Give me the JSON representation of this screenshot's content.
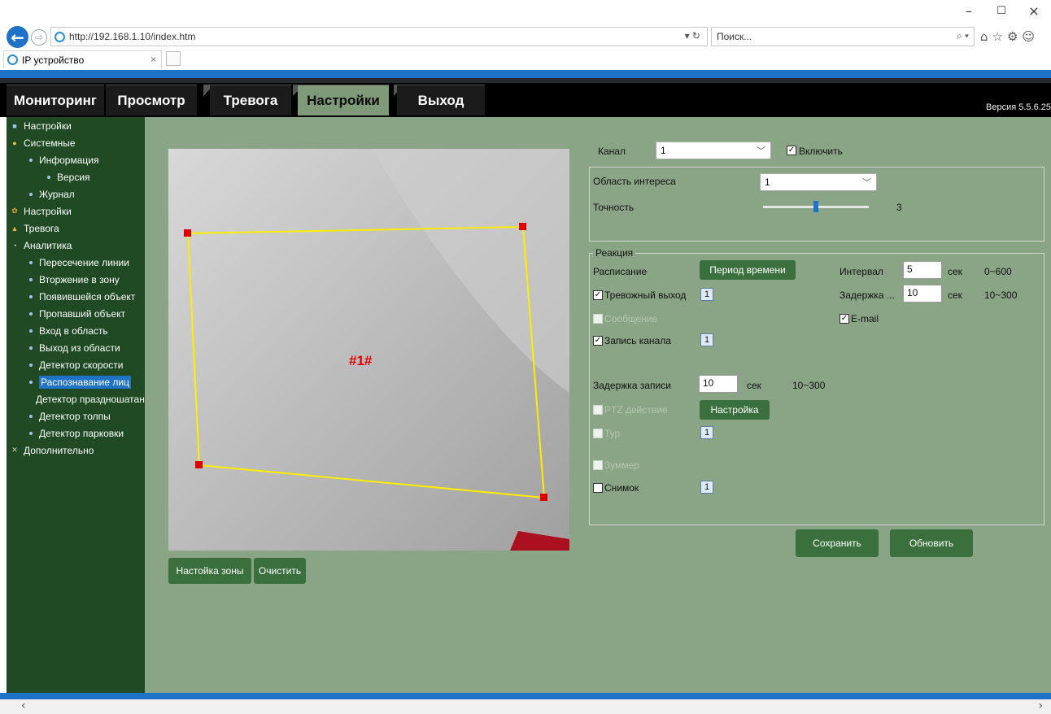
{
  "browser": {
    "url": "http://192.168.1.10/index.htm",
    "url_tools": "▾ ↻",
    "search_placeholder": "Поиск...",
    "search_tools": "⌕ ▾",
    "tab_title": "IP устройство",
    "tab_close": "×",
    "minimize": "–",
    "maximize": "☐",
    "close": "×",
    "back_glyph": "←",
    "forward_glyph": "⇨",
    "fav_icons": "⌂☆⚙☺",
    "scroll_left": "‹",
    "scroll_right": "›"
  },
  "header": {
    "tabs": [
      {
        "label": "Мониторинг"
      },
      {
        "label": "Просмотр"
      },
      {
        "label": "Тревога"
      },
      {
        "label": "Настройки",
        "active": true
      },
      {
        "label": "Выход"
      }
    ],
    "version": "Версия 5.5.6.25"
  },
  "sidebar": {
    "items": [
      {
        "label": "Настройки",
        "icon": "settings-icon",
        "glyph": "■",
        "color": "#9fc3ee"
      },
      {
        "label": "Системные",
        "icon": "system-icon",
        "glyph": "●",
        "color": "#e6c33a"
      },
      {
        "label": "Информация"
      },
      {
        "label": "Версия"
      },
      {
        "label": "Журнал"
      },
      {
        "label": "Настройки",
        "icon": "gear-icon",
        "glyph": "✿",
        "color": "#f0a030"
      },
      {
        "label": "Тревога",
        "icon": "alarm-icon",
        "glyph": "▲",
        "color": "#f0b040"
      },
      {
        "label": "Аналитика",
        "icon": "analytics-icon",
        "glyph": "◔",
        "color": "#dddddd"
      },
      {
        "label": "Пересечение линии"
      },
      {
        "label": "Вторжение в зону"
      },
      {
        "label": "Появившейся объект"
      },
      {
        "label": "Пропавший объект"
      },
      {
        "label": "Вход в область"
      },
      {
        "label": "Выход из области"
      },
      {
        "label": "Детектор скорости"
      },
      {
        "label": "Распознавание лиц",
        "selected": true
      },
      {
        "label": "Детектор праздношатания"
      },
      {
        "label": "Детектор толпы"
      },
      {
        "label": "Детектор парковки"
      },
      {
        "label": "Дополнительно",
        "icon": "tools-icon",
        "glyph": "✕",
        "color": "#cccccc"
      }
    ]
  },
  "video": {
    "zone_label": "#1#",
    "zone_color": "#ffee00",
    "handle_color": "#dd0000"
  },
  "zone_buttons": {
    "setup": "Настойка зоны",
    "clear": "Очистить"
  },
  "settings": {
    "channel_label": "Канал",
    "channel_value": "1",
    "enable_label": "Включить",
    "enable_checked": true,
    "roi_label": "Область интереса",
    "roi_value": "1",
    "accuracy_label": "Точность",
    "accuracy_value": "3",
    "accuracy_level": 0.5,
    "reaction_legend": "Реакция",
    "schedule_label": "Расписание",
    "schedule_button": "Период времени",
    "interval_label": "Интервал",
    "interval_value": "5",
    "interval_unit": "сек",
    "interval_range": "0~600",
    "alarm_out_label": "Тревожный выход",
    "alarm_out_num": "1",
    "delay_label": "Задержка ...",
    "delay_value": "10",
    "delay_unit": "сек",
    "delay_range": "10~300",
    "message_label": "Сообщение",
    "email_label": "E-mail",
    "record_label": "Запись канала",
    "record_num": "1",
    "rec_delay_label": "Задержка записи",
    "rec_delay_value": "10",
    "rec_delay_unit": "сек",
    "rec_delay_range": "10~300",
    "ptz_label": "PTZ действие",
    "ptz_button": "Настройка",
    "tour_label": "Тур",
    "tour_num": "1",
    "buzzer_label": "Зуммер",
    "snapshot_label": "Снимок",
    "snapshot_num": "1",
    "save_button": "Сохранить",
    "refresh_button": "Обновить"
  }
}
